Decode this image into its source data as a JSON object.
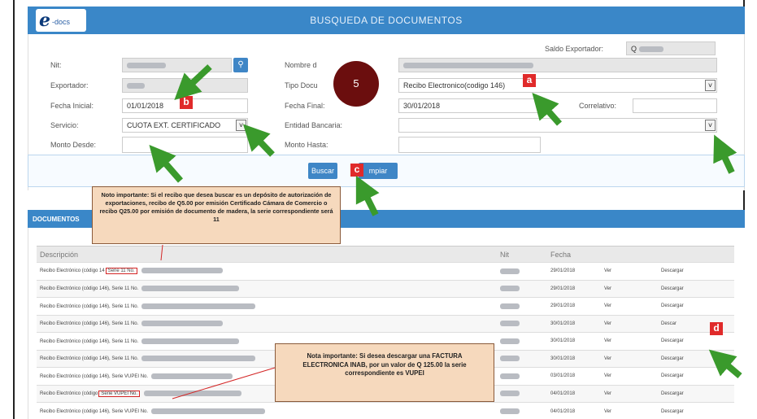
{
  "header": {
    "title": "BUSQUEDA DE DOCUMENTOS",
    "logo_mark": "e",
    "logo_text": "-docs"
  },
  "form": {
    "saldo_label": "Saldo Exportador:",
    "saldo_prefix": "Q",
    "nit_label": "Nit:",
    "nombre_label": "Nombre d",
    "exportador_label": "Exportador:",
    "tipo_label": "Tipo Docu",
    "tipo_value": "Recibo Electronico(codigo 146)",
    "fecha_inicial_label": "Fecha Inicial:",
    "fecha_inicial_value": "01/01/2018",
    "fecha_final_label": "Fecha Final:",
    "fecha_final_value": "30/01/2018",
    "correlativo_label": "Correlativo:",
    "servicio_label": "Servicio:",
    "servicio_value": "CUOTA EXT. CERTIFICADO",
    "entidad_label": "Entidad Bancaria:",
    "monto_desde_label": "Monto Desde:",
    "monto_hasta_label": "Monto Hasta:",
    "buscar_label": "Buscar",
    "limpiar_label": "mpiar"
  },
  "results": {
    "title": "DOCUMENTOS",
    "columns": [
      "Descripción",
      "Nit",
      "Fecha"
    ],
    "rows": [
      {
        "desc_prefix": "Recibo Electrónico (código 14",
        "serie": "Serie 11 No.",
        "fecha": "29/01/2018",
        "ver": "Ver",
        "descargar": "Descargar"
      },
      {
        "desc_prefix": "Recibo Electrónico (código 146), Serie 11 No.",
        "serie": "",
        "fecha": "29/01/2018",
        "ver": "Ver",
        "descargar": "Descargar"
      },
      {
        "desc_prefix": "Recibo Electrónico (código 146), Serie 11 No.",
        "serie": "",
        "fecha": "29/01/2018",
        "ver": "Ver",
        "descargar": "Descargar"
      },
      {
        "desc_prefix": "Recibo Electrónico (código 146), Serie 11 No.",
        "serie": "",
        "fecha": "30/01/2018",
        "ver": "Ver",
        "descargar": "Descar"
      },
      {
        "desc_prefix": "Recibo Electrónico (código 146), Serie 11 No.",
        "serie": "",
        "fecha": "30/01/2018",
        "ver": "Ver",
        "descargar": "Descargar"
      },
      {
        "desc_prefix": "Recibo Electrónico (código 146), Serie 11 No.",
        "serie": "",
        "fecha": "30/01/2018",
        "ver": "Ver",
        "descargar": "Descargar"
      },
      {
        "desc_prefix": "Recibo Electrónico (código 146), Serie VUPEI No.",
        "serie": "",
        "fecha": "03/01/2018",
        "ver": "Ver",
        "descargar": "Descargar"
      },
      {
        "desc_prefix": "Recibo Electrónico (código",
        "serie": "Serie VUPEI No.",
        "fecha": "04/01/2018",
        "ver": "Ver",
        "descargar": "Descargar"
      },
      {
        "desc_prefix": "Recibo Electrónico (código 146), Serie VUPEI No.",
        "serie": "",
        "fecha": "04/01/2018",
        "ver": "Ver",
        "descargar": "Descargar"
      }
    ]
  },
  "annotations": {
    "step_number": "5",
    "tag_a": "a",
    "tag_b": "b",
    "tag_c": "c",
    "tag_d": "d",
    "note1": "Noto importante: Si el recibo que desea buscar es un depósito de autorización de exportaciones, recibo de Q5.00 por emisión Certificado Cámara de Comercio o recibo Q25.00 por emisión de documento de madera, la serie correspondiente será 11",
    "note2": "Nota importante: Si desea descargar una FACTURA ELECTRONICA INAB, por un valor de Q 125.00 la serie correspondiente es VUPEI",
    "arrow_color": "#3a9a2c",
    "tag_color": "#e02a2a",
    "note_bg": "#f6d9bd"
  },
  "colors": {
    "header_blue": "#3a87c8",
    "link_blue": "#2a6bb5"
  }
}
